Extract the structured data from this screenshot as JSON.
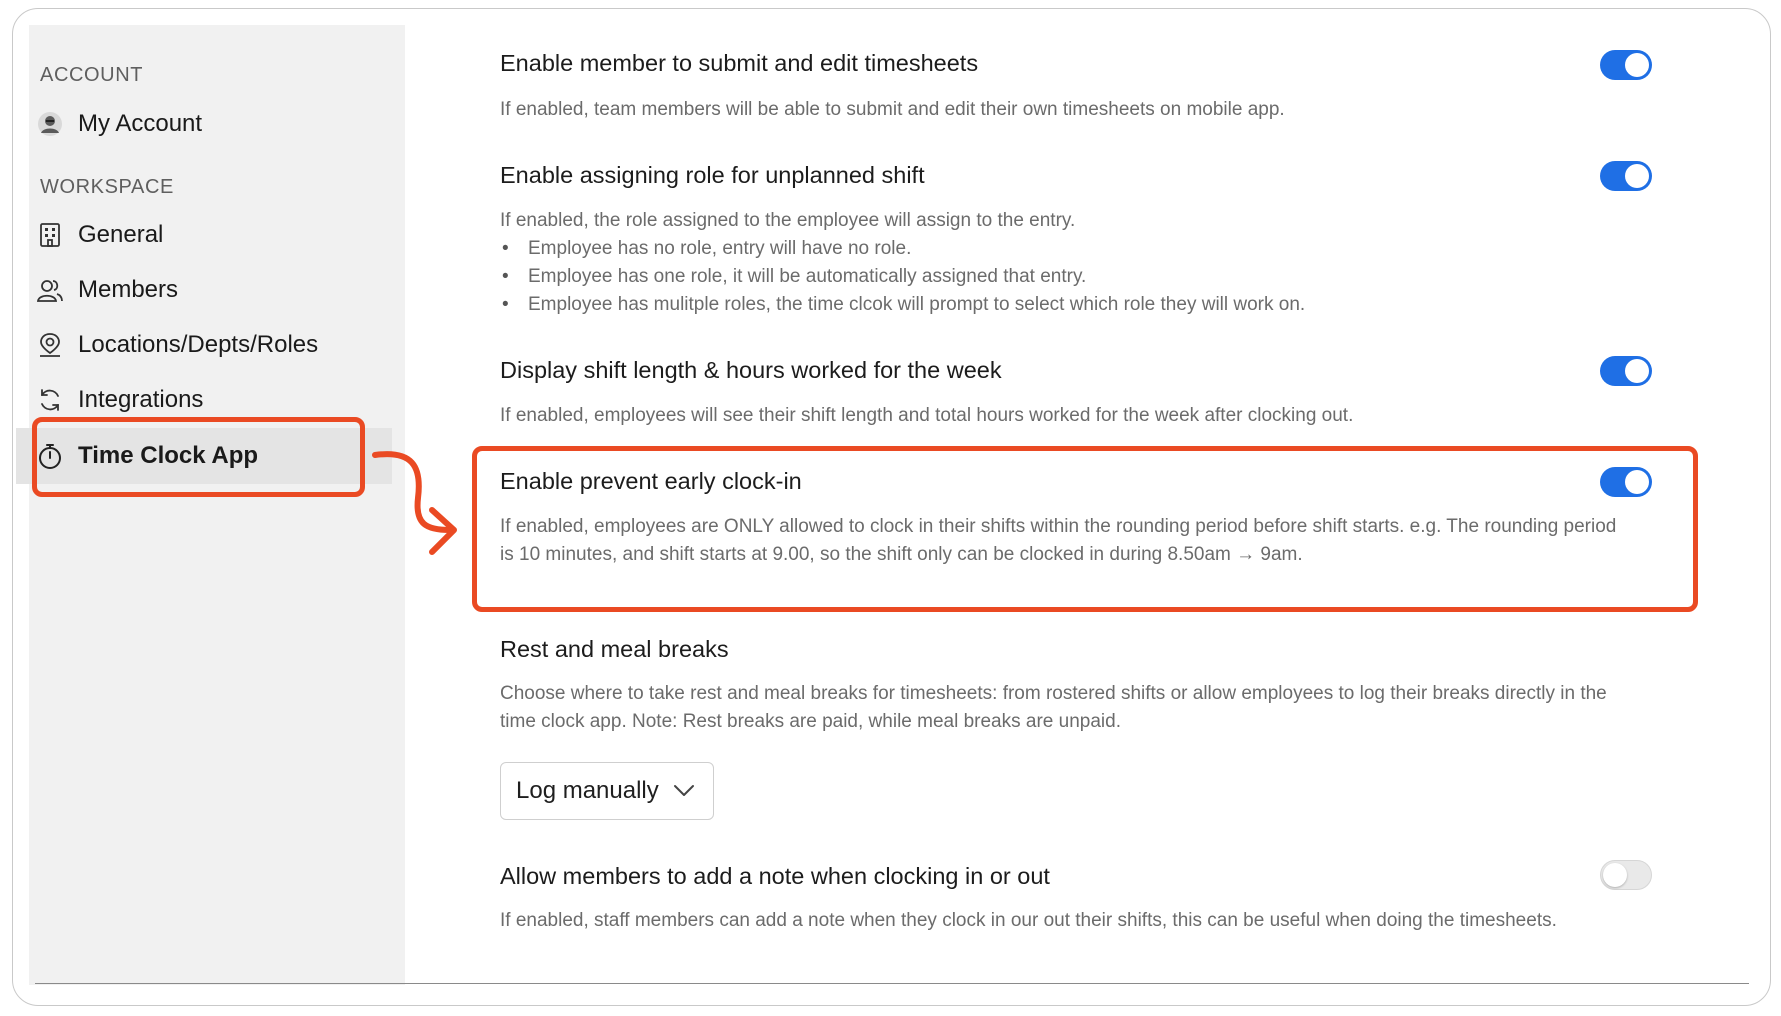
{
  "colors": {
    "accent": "#1f6fe5",
    "highlight": "#ea4a23"
  },
  "sidebar": {
    "account_section": "ACCOUNT",
    "account_items": [
      {
        "label": "My Account",
        "icon": "avatar-icon"
      }
    ],
    "workspace_section": "WORKSPACE",
    "workspace_items": [
      {
        "label": "General",
        "icon": "building-icon"
      },
      {
        "label": "Members",
        "icon": "members-icon"
      },
      {
        "label": "Locations/Depts/Roles",
        "icon": "location-pin-icon"
      },
      {
        "label": "Integrations",
        "icon": "sync-icon"
      },
      {
        "label": "Time Clock App",
        "icon": "stopwatch-icon",
        "active": true
      }
    ]
  },
  "settings": [
    {
      "title": "Enable member to submit and edit timesheets",
      "description": "If enabled, team members will be able to submit and edit their own timesheets on mobile app.",
      "enabled": true
    },
    {
      "title": "Enable assigning role for unplanned shift",
      "description": "If enabled, the role assigned to the employee will assign to the entry.",
      "bullets": [
        "Employee has no role, entry will have no role.",
        "Employee has one role, it will be automatically assigned that entry.",
        "Employee has mulitple roles, the time clcok will prompt to select which role they will work on."
      ],
      "enabled": true
    },
    {
      "title": "Display shift length & hours worked for the week",
      "description": "If enabled, employees will see their shift length and total hours worked for the week after clocking out.",
      "enabled": true
    },
    {
      "title": "Enable prevent early clock-in",
      "description": "If enabled, employees are ONLY allowed to clock in their shifts within the rounding period before shift starts. e.g. The rounding period is 10 minutes, and shift starts at 9.00, so the shift only can be clocked in during 8.50am → 9am.",
      "enabled": true
    },
    {
      "title": "Rest and meal breaks",
      "description": "Choose where to take rest and meal breaks for timesheets: from rostered shifts or allow employees to log their breaks directly in the time clock app. Note: Rest breaks are paid, while meal breaks are unpaid.",
      "select_value": "Log manually"
    },
    {
      "title": "Allow members to add a note when clocking in or out",
      "description": "If enabled, staff members can add a note when they clock in our out their shifts, this can be useful when doing the timesheets.",
      "enabled": false
    }
  ]
}
